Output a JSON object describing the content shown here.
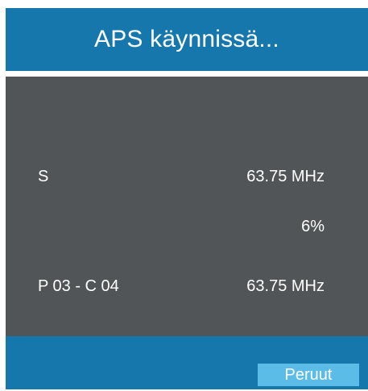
{
  "dialog": {
    "title": "APS käynnissä...",
    "rows": [
      {
        "left": "S",
        "right": "63.75 MHz"
      },
      {
        "left": "",
        "right": "6%"
      },
      {
        "left": "P 03 - C 04",
        "right": "63.75 MHz"
      }
    ],
    "progress_percent": 6,
    "cancel_label": "Peruut"
  },
  "colors": {
    "header": "#1677ac",
    "body": "#525557",
    "button": "#5bbde7",
    "text": "#ffffff"
  }
}
